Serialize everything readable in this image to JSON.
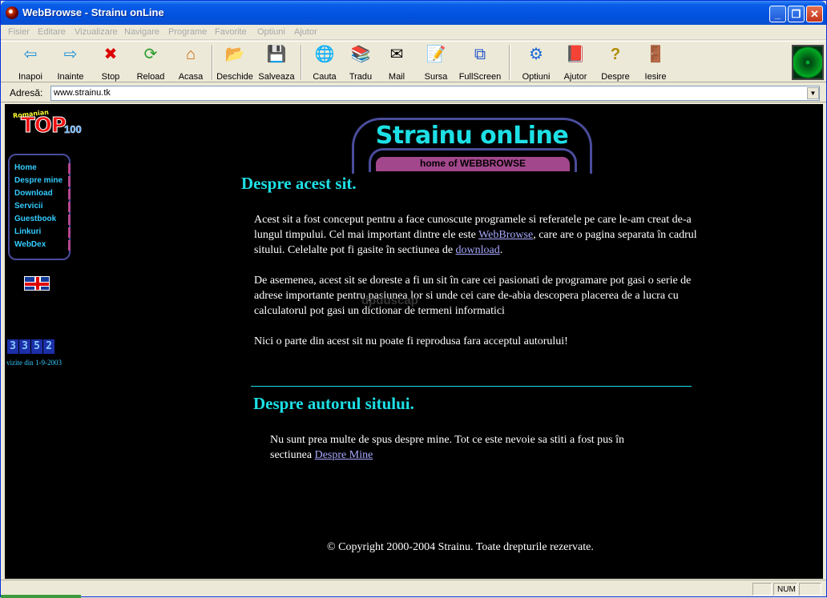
{
  "window": {
    "title": "WebBrowse - Strainu onLine"
  },
  "menu": [
    "Fisier",
    "Editare",
    "Vizualizare",
    "Navigare",
    "Programe",
    "Favorite",
    "Optiuni",
    "Ajutor"
  ],
  "toolbar": {
    "back": "Inapoi",
    "forward": "Inainte",
    "stop": "Stop",
    "reload": "Reload",
    "home": "Acasa",
    "open": "Deschide",
    "save": "Salveaza",
    "search": "Cauta",
    "translate": "Tradu",
    "mail": "Mail",
    "source": "Sursa",
    "fullscreen": "FullScreen",
    "options": "Optiuni",
    "help": "Ajutor",
    "about": "Despre",
    "exit": "Iesire"
  },
  "address": {
    "label": "Adresă:",
    "value": "www.strainu.tk"
  },
  "page": {
    "top100_small": "Romanian",
    "top100_big": "TOP",
    "top100_num": "100",
    "nav": [
      "Home",
      "Despre mine",
      "Download",
      "Servicii",
      "Guestbook",
      "Linkuri",
      "WebDex"
    ],
    "counter_digits": [
      "3",
      "3",
      "5",
      "2"
    ],
    "counter_caption": "vizite din 1-9-2003",
    "banner_title": "Strainu onLine",
    "banner_sub": "home of WEBBROWSE",
    "heading_about": "Despre acest sit.",
    "p1_a": "Acest sit a fost conceput pentru a face cunoscute programele si referatele pe care le-am creat de-a lungul timpului. Cel mai important dintre ele este ",
    "p1_link1": "WebBrowse",
    "p1_b": ", care are o pagina separata în cadrul sitului. Celelalte pot fi gasite în sectiunea de ",
    "p1_link2": "download",
    "p1_c": ".",
    "p2": "De asemenea, acest sit se doreste a fi un sit în care cei pasionati de programare pot gasi o serie de adrese importante pentru pasiunea lor si unde cei care de-abia descopera placerea de a lucra cu calculatorul pot gasi un dictionar de termeni informatici",
    "p3": "Nici o parte din acest sit nu poate fi reprodusa fara acceptul autorului!",
    "heading_author": "Despre autorul sitului.",
    "p4_a": "Nu sunt prea multe de spus despre mine. Tot ce este nevoie sa stiti a fost pus în sectiunea ",
    "p4_link": "Despre Mine",
    "copyright": "© Copyright 2000-2004 Strainu. Toate drepturile rezervate.",
    "watermark": "dpduscap"
  },
  "status": {
    "num": "NUM"
  }
}
